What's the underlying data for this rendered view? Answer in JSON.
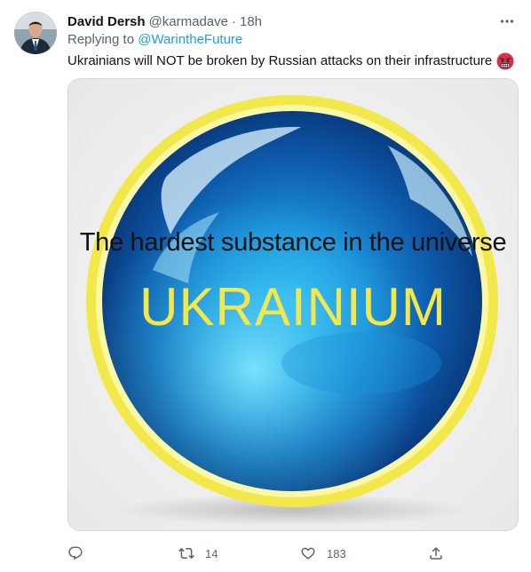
{
  "tweet": {
    "author_name": "David Dersh",
    "author_handle": "@karmadave",
    "separator": "·",
    "time": "18h",
    "replying_prefix": "Replying to ",
    "replying_to": "@WarintheFuture",
    "text": "Ukrainians will NOT be broken by Russian attacks on their infrastructure",
    "emoji_icon": "angry-face-emoji-icon",
    "more_icon": "more-horizontal-icon"
  },
  "media": {
    "line1": "The hardest substance in the universe",
    "line2": "UKRAINIUM",
    "colors": {
      "ring": "#f2e74b",
      "orb_light": "#4fd0f5",
      "orb_dark": "#0a2f7a",
      "background": "#f4f4f4"
    }
  },
  "actions": {
    "reply": {
      "icon": "reply-icon",
      "count": ""
    },
    "retweet": {
      "icon": "retweet-icon",
      "count": "14"
    },
    "like": {
      "icon": "heart-icon",
      "count": "183"
    },
    "share": {
      "icon": "share-icon",
      "count": ""
    }
  }
}
